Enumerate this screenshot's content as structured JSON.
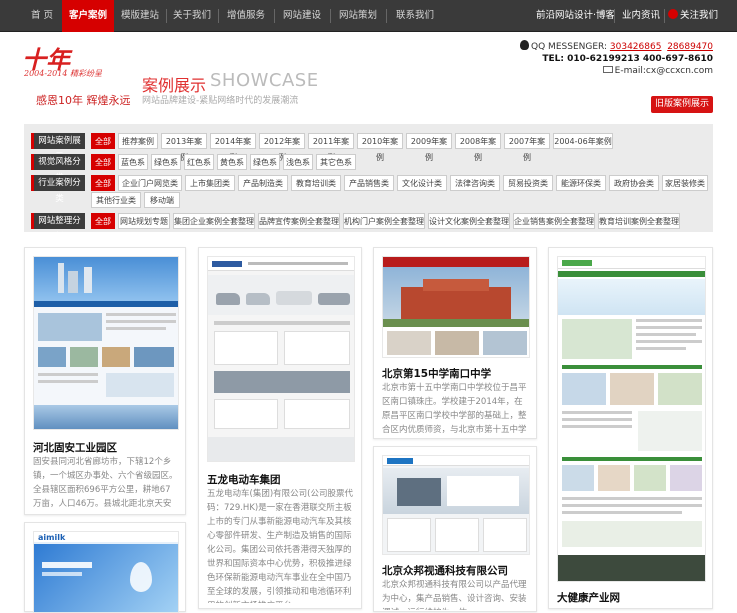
{
  "nav": {
    "items": [
      {
        "label": "首 页"
      },
      {
        "label": "客户案例"
      },
      {
        "label": "模版建站"
      },
      {
        "label": "关于我们"
      },
      {
        "label": "增值服务"
      },
      {
        "label": "网站建设"
      },
      {
        "label": "网站策划"
      },
      {
        "label": "联系我们"
      }
    ],
    "right_link1": "前沿网站设计·博客",
    "right_link2": "业内资讯",
    "follow": "关注我们"
  },
  "header": {
    "logo_mark": "十年",
    "logo_years": "2004-2014 精彩纷呈",
    "slogan": "感恩10年 辉煌永远",
    "title_cn": "案例展示",
    "title_en": "SHOWCASE",
    "subtitle": "网站品牌建设-紧贴网络时代的发展潮流",
    "qq_label": "QQ MESSENGER:",
    "qq1": "303426865",
    "qq2": "28689470",
    "tel": "TEL: 010-62199213   400-697-8610",
    "email": "E-mail:cx@ccxcn.com",
    "old_case_button": "旧版案例展示"
  },
  "filters": [
    {
      "label": "网站案例展示",
      "options": [
        "全部",
        "推荐案例",
        "2013年案例",
        "2014年案例",
        "2012年案例",
        "2011年案例",
        "2010年案例",
        "2009年案例",
        "2008年案例",
        "2007年案例",
        "2004-06年案例"
      ]
    },
    {
      "label": "视觉风格分类",
      "options": [
        "全部",
        "蓝色系",
        "绿色系",
        "红色系",
        "黄色系",
        "绿色系",
        "浅色系",
        "其它色系"
      ]
    },
    {
      "label": "行业案例分类",
      "options": [
        "全部",
        "企业门户网览类",
        "上市集团类",
        "产品制造类",
        "教育培训类",
        "产品销售类",
        "文化设计类",
        "法律咨询类",
        "贸易投资类",
        "能源环保类",
        "政府协会类",
        "家居装修类",
        "其他行业类",
        "移动端"
      ]
    },
    {
      "label": "网站整理分析",
      "options": [
        "全部",
        "网站规划专题",
        "集团企业案例全套整理",
        "品牌宣传案例全套整理",
        "机构门户案例全套整理",
        "设计文化案例全套整理",
        "企业销售案例全套整理",
        "教育培训案例全套整理"
      ]
    }
  ],
  "cards": [
    {
      "title": "河北固安工业园区",
      "desc": "固安县同河北省廊坊市，下辖12个乡镇，一个城区办事处、六个省级园区。全县辖区面积696平方公里，耕地67万亩，人口46万。县城北距北京天安门50公里，与北京市交相祖连。"
    },
    {
      "title": "五龙电动车集团",
      "desc": "五龙电动车(集团)有限公司(公司股票代码：729.HK)是一家在香港联交所主板上市的专门从事新能源电动汽车及其核心零部件研发、生产制造及销售的国际化公司。集团公司依托香港得天独厚的世界和国际资本中心优势，积极推进绿色环保新能源电动汽车事业在全中国乃至全球的发展，引领推动和电池循环利用的创新市场推广平台。"
    },
    {
      "title": "北京第15中学南口中学",
      "desc": "北京市第十五中学南口中学校位于昌平区南口镇珠庄。学校建于2014年，在原昌平区南口学校中学部的基础上，整合区内优质师资，与北京市第十五中学合作办学而成立的一所新校。"
    },
    {
      "title": "北京众邦视通科技有限公司",
      "desc": "北京众邦视通科技有限公司以产品代理为中心，集产品销售、设计咨询、安装调试、运行维护为一体。"
    },
    {
      "title": "大健康产业网",
      "desc": ""
    },
    {
      "title": "",
      "desc": "",
      "thumb_text": "aimilk"
    }
  ]
}
